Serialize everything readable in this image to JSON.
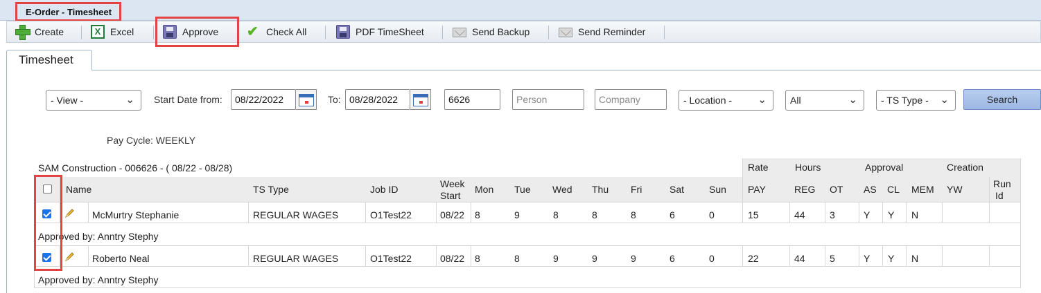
{
  "window": {
    "title": "E-Order - Timesheet"
  },
  "toolbar": {
    "create": "Create",
    "excel": "Excel",
    "approve": "Approve",
    "check_all": "Check All",
    "pdf": "PDF TimeSheet",
    "send_backup": "Send Backup",
    "send_reminder": "Send Reminder"
  },
  "tab": {
    "label": "Timesheet"
  },
  "filters": {
    "view": "- View -",
    "start_label": "Start Date from:",
    "start_date": "08/22/2022",
    "to_label": "To:",
    "end_date": "08/28/2022",
    "company_id": "6626",
    "person_placeholder": "Person",
    "company_placeholder": "Company",
    "location": "- Location -",
    "status": "All",
    "ts_type": "- TS Type -",
    "search": "Search"
  },
  "pay_cycle": "Pay Cycle: WEEKLY",
  "grid": {
    "group_title": "SAM Construction - 006626 - ( 08/22 - 08/28)",
    "group_headers": {
      "rate": "Rate",
      "hours": "Hours",
      "approval": "Approval",
      "creation": "Creation"
    },
    "columns": {
      "name": "Name",
      "ts_type": "TS Type",
      "job_id": "Job ID",
      "week_start_1": "Week",
      "week_start_2": "Start",
      "mon": "Mon",
      "tue": "Tue",
      "wed": "Wed",
      "thu": "Thu",
      "fri": "Fri",
      "sat": "Sat",
      "sun": "Sun",
      "pay": "PAY",
      "reg": "REG",
      "ot": "OT",
      "as": "AS",
      "cl": "CL",
      "mem": "MEM",
      "yw": "YW",
      "run_id_1": "Run",
      "run_id_2": "Id"
    },
    "rows": [
      {
        "checked": true,
        "name": "McMurtry Stephanie",
        "ts_type": "REGULAR WAGES",
        "job_id": "O1Test22",
        "week": "08/22",
        "mon": "8",
        "tue": "9",
        "wed": "8",
        "thu": "8",
        "fri": "8",
        "sat": "6",
        "sun": "0",
        "pay": "15",
        "reg": "44",
        "ot": "3",
        "as": "Y",
        "cl": "Y",
        "mem": "N",
        "approved_by": "Approved by: Anntry Stephy"
      },
      {
        "checked": true,
        "name": "Roberto Neal",
        "ts_type": "REGULAR WAGES",
        "job_id": "O1Test22",
        "week": "08/22",
        "mon": "8",
        "tue": "8",
        "wed": "9",
        "thu": "9",
        "fri": "9",
        "sat": "6",
        "sun": "0",
        "pay": "22",
        "reg": "44",
        "ot": "5",
        "as": "Y",
        "cl": "Y",
        "mem": "N",
        "approved_by": "Approved by: Anntry Stephy"
      }
    ]
  },
  "colors": {
    "highlight": "#e24444",
    "checkbox": "#1a73e8",
    "titlebar": "#dce6f2",
    "search_button": "#9db8e3"
  }
}
